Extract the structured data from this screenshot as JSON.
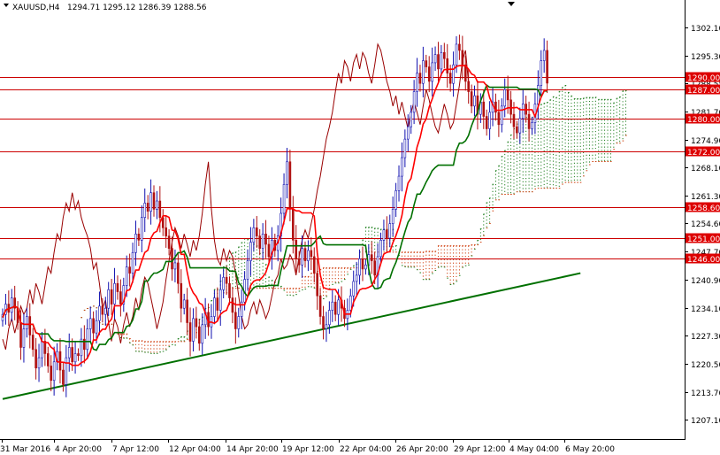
{
  "header": {
    "symbol": "XAUUSD,H4",
    "ohlc": "1294.71 1295.12 1286.39 1288.56"
  },
  "chart_data": {
    "type": "candlestick",
    "ylim": [
      1204.0,
      1307.0
    ],
    "y_ticks": [
      "1302.10",
      "1295.30",
      "1288.55",
      "1281.70",
      "1274.90",
      "1268.10",
      "1261.30",
      "1254.60",
      "1247.70",
      "1240.90",
      "1234.10",
      "1227.30",
      "1220.50",
      "1213.70",
      "1207.10"
    ],
    "x_labels": [
      "31 Mar 2016",
      "4 Apr 20:00",
      "7 Apr 12:00",
      "12 Apr 04:00",
      "14 Apr 20:00",
      "19 Apr 12:00",
      "22 Apr 04:00",
      "26 Apr 20:00",
      "29 Apr 12:00",
      "4 May 04:00",
      "6 May 20:00"
    ],
    "levels": [
      {
        "value": 1290.0,
        "label": "1290.00"
      },
      {
        "value": 1287.0,
        "label": "1287.00"
      },
      {
        "value": 1280.0,
        "label": "1280.00"
      },
      {
        "value": 1272.0,
        "label": "1272.00"
      },
      {
        "value": 1258.6,
        "label": "1258.60"
      },
      {
        "value": 1251.0,
        "label": "1251.00"
      },
      {
        "value": 1246.0,
        "label": "1246.00"
      }
    ],
    "trendline": {
      "start": [
        0,
        1212.0
      ],
      "end": [
        191,
        1242.5
      ]
    },
    "colors": {
      "bull": "#1010b0",
      "bear": "#b01010",
      "tenkan": "#ff0000",
      "kijun": "#007000",
      "chikou": "#990000",
      "level": "#cc0000",
      "trend": "#007000",
      "cloud_bull": "#208020",
      "cloud_bear": "#d04010"
    },
    "candles_close": [
      1232.5,
      1235.0,
      1233.0,
      1236.5,
      1234.0,
      1230.5,
      1224.5,
      1229.0,
      1232.0,
      1227.5,
      1224.0,
      1219.5,
      1222.0,
      1226.0,
      1223.0,
      1220.0,
      1216.5,
      1221.0,
      1223.5,
      1219.0,
      1215.5,
      1222.0,
      1224.5,
      1221.0,
      1223.0,
      1222.5,
      1226.5,
      1224.0,
      1229.0,
      1231.5,
      1228.0,
      1231.0,
      1234.5,
      1232.5,
      1234.0,
      1238.5,
      1235.0,
      1240.0,
      1238.0,
      1235.0,
      1239.5,
      1244.0,
      1242.5,
      1247.5,
      1252.0,
      1250.5,
      1256.0,
      1259.5,
      1257.5,
      1262.0,
      1258.0,
      1260.0,
      1256.0,
      1253.5,
      1251.5,
      1248.5,
      1243.5,
      1245.0,
      1240.0,
      1234.0,
      1236.0,
      1230.5,
      1226.0,
      1231.5,
      1229.5,
      1225.5,
      1230.0,
      1233.0,
      1229.5,
      1232.0,
      1236.5,
      1233.5,
      1238.5,
      1241.5,
      1240.0,
      1236.5,
      1233.0,
      1229.0,
      1232.0,
      1235.5,
      1241.0,
      1245.5,
      1250.0,
      1253.5,
      1251.5,
      1248.5,
      1252.0,
      1249.5,
      1246.5,
      1250.5,
      1248.0,
      1251.5,
      1257.0,
      1264.0,
      1269.5,
      1258.0,
      1250.5,
      1246.0,
      1244.5,
      1248.5,
      1245.5,
      1248.0,
      1246.5,
      1242.5,
      1237.0,
      1232.0,
      1229.0,
      1230.0,
      1233.5,
      1235.5,
      1232.5,
      1236.0,
      1234.0,
      1231.5,
      1233.5,
      1237.0,
      1240.5,
      1242.0,
      1246.0,
      1243.5,
      1244.5,
      1247.0,
      1245.5,
      1242.0,
      1246.5,
      1250.5,
      1253.0,
      1251.0,
      1254.5,
      1258.0,
      1262.5,
      1266.0,
      1270.5,
      1275.0,
      1278.0,
      1281.5,
      1286.5,
      1291.0,
      1288.5,
      1294.0,
      1292.5,
      1289.0,
      1293.5,
      1295.5,
      1292.0,
      1296.0,
      1294.5,
      1291.0,
      1288.5,
      1293.0,
      1298.0,
      1296.5,
      1293.0,
      1289.0,
      1286.5,
      1283.0,
      1285.5,
      1281.0,
      1284.0,
      1280.5,
      1277.5,
      1281.5,
      1284.0,
      1281.5,
      1278.5,
      1283.0,
      1287.0,
      1284.5,
      1281.0,
      1278.0,
      1276.5,
      1280.0,
      1283.5,
      1281.0,
      1277.5,
      1279.0,
      1283.5,
      1288.0,
      1294.0,
      1296.5,
      1288.56
    ]
  }
}
